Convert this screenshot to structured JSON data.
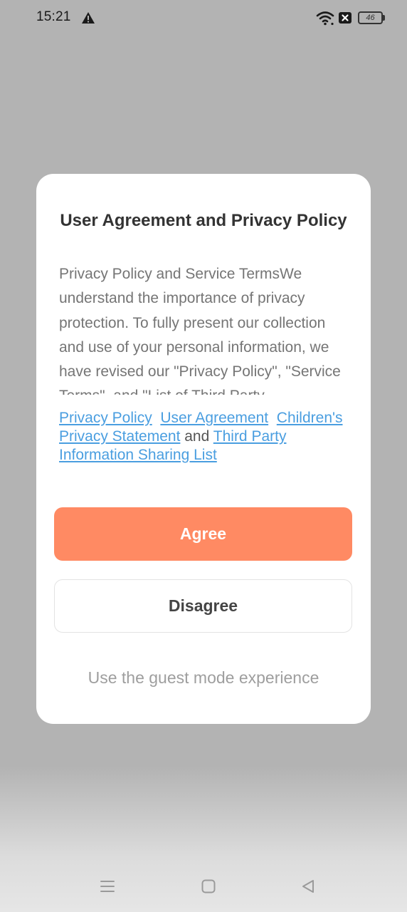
{
  "status_bar": {
    "time": "15:21",
    "battery_level": "46",
    "icons": [
      "warning-icon",
      "wifi-icon",
      "no-sim-icon",
      "battery-icon"
    ]
  },
  "dialog": {
    "title": "User Agreement and Privacy Policy",
    "body": "Privacy Policy and Service TermsWe understand the importance of privacy protection. To fully present our collection and use of your personal information, we have revised our \"Privacy Policy\", \"Service Terms\", and \"List of Third Party",
    "links": {
      "privacy_policy": "Privacy Policy",
      "user_agreement": "User Agreement",
      "childrens_privacy": "Children's Privacy Statement",
      "conjunction": "and",
      "third_party_list": "Third Party Information Sharing List"
    },
    "agree_label": "Agree",
    "disagree_label": "Disagree",
    "guest_label": "Use the guest mode experience"
  },
  "colors": {
    "overlay": "#b3b3b3",
    "accent": "#ff8a63",
    "link": "#4a9ee0"
  },
  "nav_bar": {
    "icons": [
      "menu-icon",
      "home-icon",
      "back-icon"
    ]
  }
}
